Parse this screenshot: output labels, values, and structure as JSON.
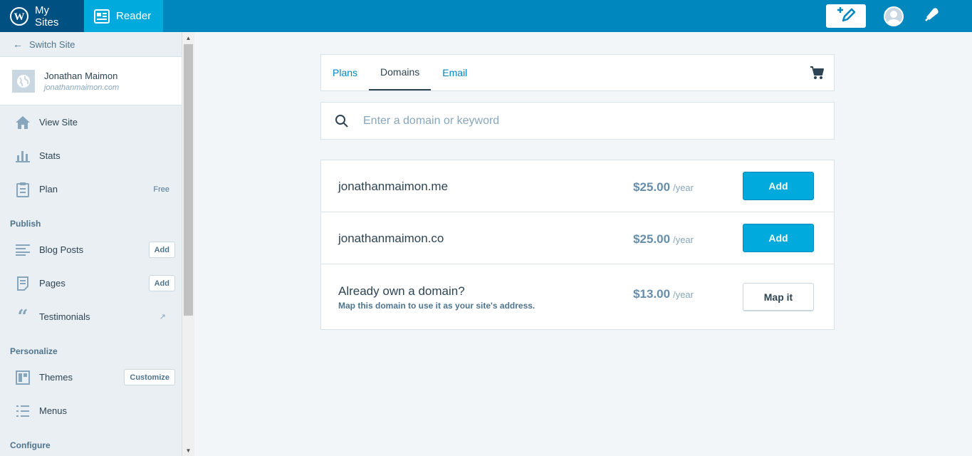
{
  "masterbar": {
    "my_sites_label": "My Sites",
    "reader_label": "Reader",
    "colors": {
      "bar": "#0087be",
      "my_sites_bg": "#005082",
      "reader_bg": "#00aadc"
    }
  },
  "sidebar": {
    "switch_site_label": "Switch Site",
    "site": {
      "name": "Jonathan Maimon",
      "domain": "jonathanmaimon.com"
    },
    "items_top": [
      {
        "label": "View Site",
        "icon": "home-icon"
      },
      {
        "label": "Stats",
        "icon": "stats-icon"
      },
      {
        "label": "Plan",
        "icon": "clipboard-icon",
        "badge": "Free"
      }
    ],
    "sections": {
      "publish": "Publish",
      "personalize": "Personalize",
      "configure": "Configure"
    },
    "publish_items": [
      {
        "label": "Blog Posts",
        "icon": "posts-icon",
        "button": "Add"
      },
      {
        "label": "Pages",
        "icon": "pages-icon",
        "button": "Add"
      },
      {
        "label": "Testimonials",
        "icon": "quote-icon"
      }
    ],
    "personalize_items": [
      {
        "label": "Themes",
        "icon": "themes-icon",
        "button": "Customize"
      },
      {
        "label": "Menus",
        "icon": "menus-icon"
      }
    ]
  },
  "tabs": [
    {
      "label": "Plans",
      "active": false
    },
    {
      "label": "Domains",
      "active": true
    },
    {
      "label": "Email",
      "active": false
    }
  ],
  "search": {
    "placeholder": "Enter a domain or keyword",
    "value": ""
  },
  "results": [
    {
      "domain": "jonathanmaimon.me",
      "price": "$25.00",
      "period": "/year",
      "button": "Add"
    },
    {
      "domain": "jonathanmaimon.co",
      "price": "$25.00",
      "period": "/year",
      "button": "Add"
    },
    {
      "domain": "Already own a domain?",
      "subtitle": "Map this domain to use it as your site's address.",
      "price": "$13.00",
      "period": "/year",
      "button": "Map it"
    }
  ]
}
